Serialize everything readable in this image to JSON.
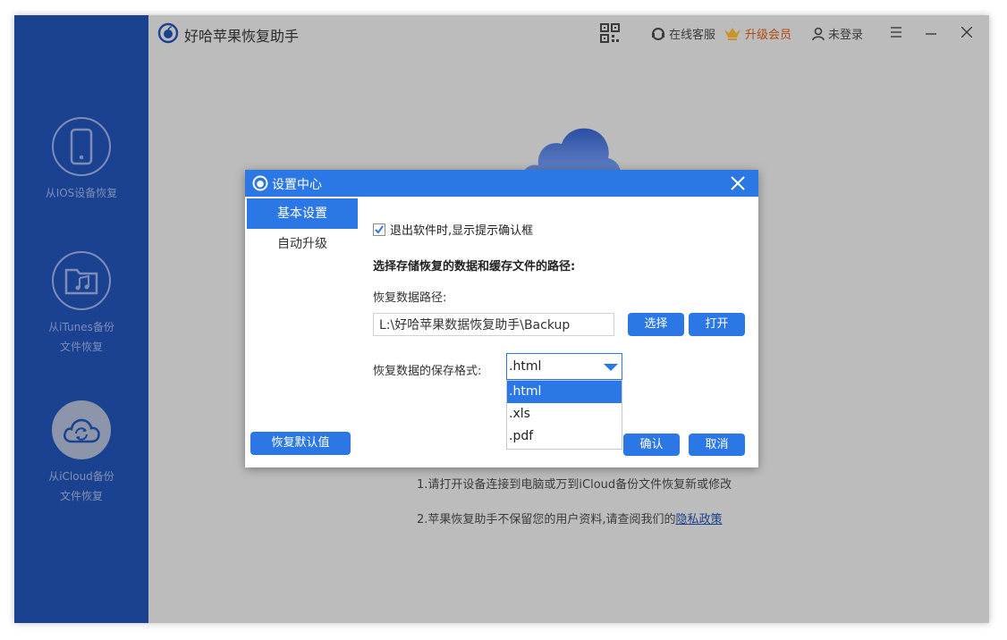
{
  "app": {
    "title": "好哈苹果恢复助手"
  },
  "titlebar": {
    "service_label": "在线客服",
    "vip_label": "升级会员",
    "login_label": "未登录"
  },
  "sidebar": {
    "items": [
      {
        "line1": "从IOS设备恢复",
        "line2": ""
      },
      {
        "line1": "从iTunes备份",
        "line2": "文件恢复"
      },
      {
        "line1": "从iCloud备份",
        "line2": "文件恢复"
      }
    ]
  },
  "main": {
    "tip1": "1.请打开设备连接到电脑或万到iCloud备份文件恢复新或修改",
    "tip2_prefix": "2.苹果恢复助手不保留您的用户资料,请查阅我们的",
    "tip2_link": "隐私政策"
  },
  "dialog": {
    "title": "设置中心",
    "nav": [
      "基本设置",
      "自动升级"
    ],
    "checkbox_label": "退出软件时,显示提示确认框",
    "checkbox_checked": true,
    "section_title": "选择存储恢复的数据和缓存文件的路径:",
    "path_label": "恢复数据路径:",
    "path_value": "L:\\好哈苹果数据恢复助手\\Backup",
    "choose_button": "选择",
    "open_button": "打开",
    "format_label": "恢复数据的保存格式:",
    "format_selected": ".html",
    "format_options": [
      ".html",
      ".xls",
      ".pdf"
    ],
    "restore_default_button": "恢复默认值",
    "ok_button": "确认",
    "cancel_button": "取消"
  },
  "colors": {
    "sidebar_bg": "#1a4291",
    "accent": "#2c77e6",
    "overlay_bg": "#bcbcbc",
    "vip": "#b04a10"
  }
}
